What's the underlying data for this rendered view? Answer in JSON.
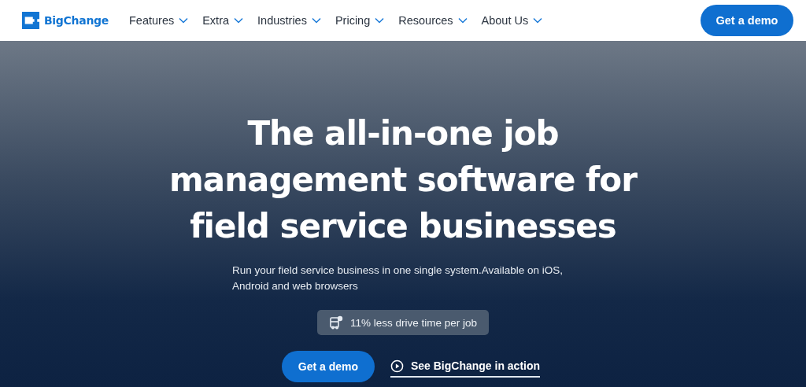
{
  "header": {
    "logo": "BigChange",
    "nav": [
      {
        "label": "Features",
        "dropdown": true
      },
      {
        "label": "Extra",
        "dropdown": true
      },
      {
        "label": "Industries",
        "dropdown": true
      },
      {
        "label": "Pricing",
        "dropdown": true
      },
      {
        "label": "Resources",
        "dropdown": true
      },
      {
        "label": "About Us",
        "dropdown": true
      }
    ],
    "cta": "Get a demo"
  },
  "hero": {
    "headline": [
      "The all-in-one job",
      "management software for",
      "field service businesses"
    ],
    "subtitle": "Run your field service business in one single system.Available on iOS, Android and web browsers",
    "badge": "11% less drive time per job",
    "primary_button": "Get a demo",
    "video_link": "See BigChange in action"
  }
}
